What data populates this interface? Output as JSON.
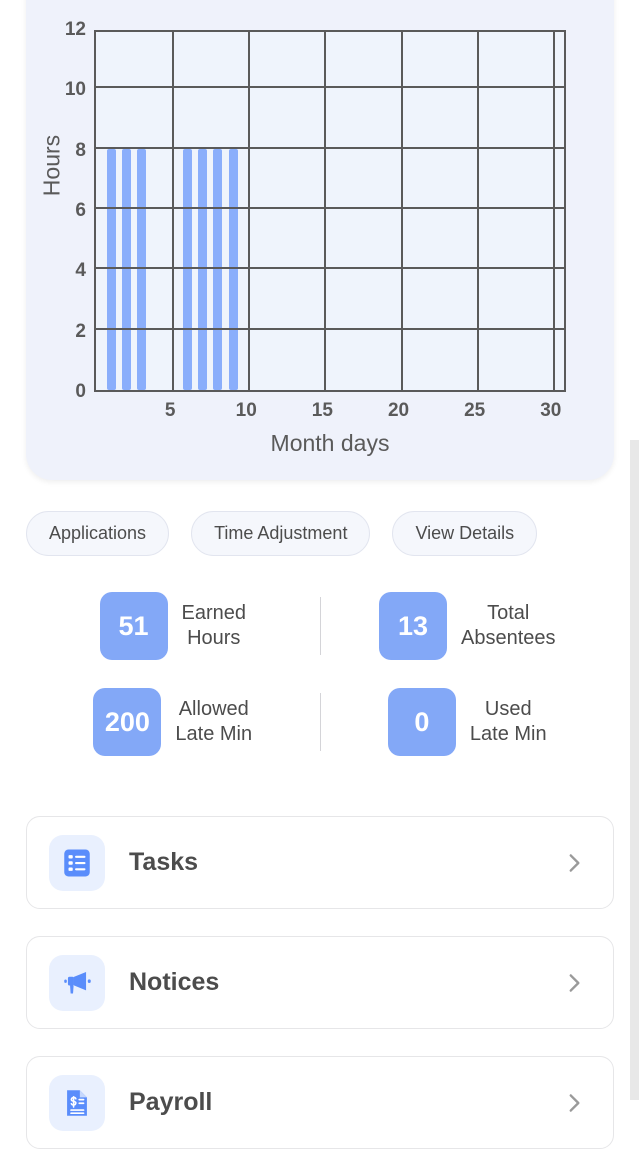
{
  "chart_data": {
    "type": "bar",
    "title": "",
    "xlabel": "Month days",
    "ylabel": "Hours",
    "xlim": [
      0,
      31
    ],
    "ylim": [
      0,
      12
    ],
    "xticks": [
      5,
      10,
      15,
      20,
      25,
      30
    ],
    "yticks": [
      0,
      2,
      4,
      6,
      8,
      10,
      12
    ],
    "grid": true,
    "legend": "none",
    "categories": [
      1,
      2,
      3,
      4,
      5,
      6,
      7,
      8,
      9,
      10,
      11,
      12,
      13,
      14,
      15,
      16,
      17,
      18,
      19,
      20,
      21,
      22,
      23,
      24,
      25,
      26,
      27,
      28,
      29,
      30
    ],
    "values": [
      8,
      8,
      8,
      0,
      0,
      8,
      8,
      8,
      8,
      0,
      0,
      0,
      0,
      0,
      0,
      0,
      0,
      0,
      0,
      0,
      0,
      0,
      0,
      0,
      0,
      0,
      0,
      0,
      0,
      0
    ],
    "bar_color": "#8aaefb",
    "plot_bg": "#eff4fc",
    "axis_color": "#5a5a5a",
    "card_bg": "#eff2fb"
  },
  "chips": [
    {
      "label": "Applications",
      "name": "chip-applications"
    },
    {
      "label": "Time Adjustment",
      "name": "chip-time-adjustment"
    },
    {
      "label": "View Details",
      "name": "chip-view-details"
    }
  ],
  "stats": {
    "rows": [
      {
        "left": {
          "value": "51",
          "line1": "Earned",
          "line2": "Hours"
        },
        "right": {
          "value": "13",
          "line1": "Total",
          "line2": "Absentees"
        }
      },
      {
        "left": {
          "value": "200",
          "line1": "Allowed",
          "line2": "Late Min"
        },
        "right": {
          "value": "0",
          "line1": "Used",
          "line2": "Late Min"
        }
      }
    ],
    "badge_color": "#83a8f7"
  },
  "list_items": [
    {
      "label": "Tasks",
      "icon": "task-list-icon",
      "chevron": "chevron-right-icon"
    },
    {
      "label": "Notices",
      "icon": "megaphone-icon",
      "chevron": "chevron-right-icon"
    },
    {
      "label": "Payroll",
      "icon": "payslip-icon",
      "chevron": "chevron-right-icon"
    }
  ],
  "accent_color": "#5a8dfb"
}
